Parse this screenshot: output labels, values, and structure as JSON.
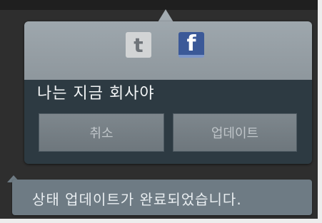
{
  "popup": {
    "share_icons": [
      {
        "icon": "twitter-icon",
        "glyph": "t"
      },
      {
        "icon": "facebook-icon",
        "glyph": "f"
      }
    ],
    "status_text": "나는 지금 회사야",
    "cancel_label": "취소",
    "update_label": "업데이트"
  },
  "toast": {
    "message": "상태 업데이트가 완료되었습니다."
  },
  "colors": {
    "facebook_blue": "#3b5998",
    "popup_header": "#9ea7ad",
    "popup_body": "#2d3a42",
    "toast_bg": "#6e7b84"
  }
}
